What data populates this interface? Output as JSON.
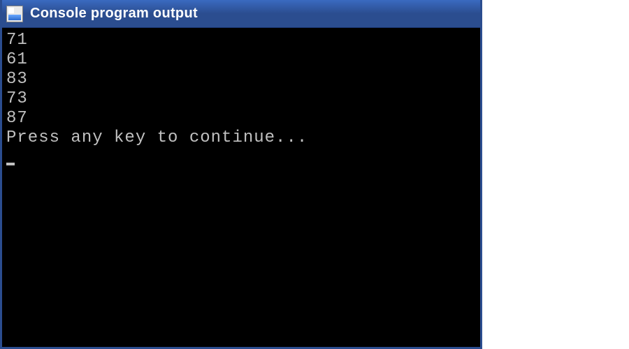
{
  "window": {
    "title": "Console program output"
  },
  "console": {
    "lines": [
      "71",
      "61",
      "83",
      "73",
      "87"
    ],
    "prompt": "Press any key to continue..."
  }
}
